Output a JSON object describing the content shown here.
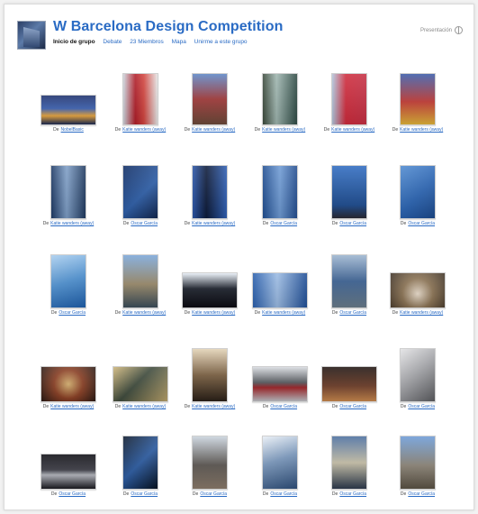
{
  "header": {
    "title": "W Barcelona Design Competition",
    "nav": [
      {
        "label": "Inicio de grupo",
        "current": true
      },
      {
        "label": "Debate",
        "current": false
      },
      {
        "label": "23 Miembros",
        "current": false
      },
      {
        "label": "Mapa",
        "current": false
      },
      {
        "label": "Unirme a este grupo",
        "current": false
      }
    ],
    "top_right": "Presentación"
  },
  "by_label": "De",
  "rows": [
    [
      {
        "author": "NobelBasic",
        "w": 62,
        "h": 34,
        "bg": "linear-gradient(180deg,#1c2f6b 0%,#3a5fb0 45%,#e6a33c 70%,#1a2a55 100%)"
      },
      {
        "author": "Katie wanders (away)",
        "w": 40,
        "h": 58,
        "bg": "linear-gradient(90deg,#cfd6de 0%,#b01f2a 35%,#d2453f 60%,#e6e6e6 100%)"
      },
      {
        "author": "Katie wanders (away)",
        "w": 40,
        "h": 58,
        "bg": "linear-gradient(180deg,#5d86c6 0%,#a23a3a 50%,#6b4a3a 100%)"
      },
      {
        "author": "Katie wanders (away)",
        "w": 40,
        "h": 58,
        "bg": "linear-gradient(90deg,#3b4a3c 0%,#9fb6b0 40%,#2e4a44 100%)"
      },
      {
        "author": "Katie wanders (away)",
        "w": 40,
        "h": 58,
        "bg": "linear-gradient(90deg,#b3c6dd 0%,#cf2b3c 40%,#c43044 100%)"
      },
      {
        "author": "Katie wanders (away)",
        "w": 40,
        "h": 58,
        "bg": "linear-gradient(180deg,#3a5ba8 0%,#c33b35 55%,#e0b43a 100%)"
      }
    ],
    [
      {
        "author": "Katie wanders (away)",
        "w": 40,
        "h": 60,
        "bg": "linear-gradient(90deg,#1f3b66 0%,#7f9fc7 45%,#203a60 100%)"
      },
      {
        "author": "Oscar García",
        "w": 40,
        "h": 60,
        "bg": "linear-gradient(135deg,#0f2c63 0%,#2d5ea8 55%,#13274f 100%)"
      },
      {
        "author": "Katie wanders (away)",
        "w": 40,
        "h": 60,
        "bg": "linear-gradient(90deg,#2a55a8 0%,#0d1b3a 40%,#2f5fb4 100%)"
      },
      {
        "author": "Oscar García",
        "w": 40,
        "h": 60,
        "bg": "linear-gradient(90deg,#214f92 0%,#6f9bd4 50%,#234d8f 100%)"
      },
      {
        "author": "Oscar García",
        "w": 40,
        "h": 60,
        "bg": "linear-gradient(180deg,#2f6bc0 0%,#1c4b8f 75%,#2a2a35 100%)"
      },
      {
        "author": "Oscar García",
        "w": 40,
        "h": 60,
        "bg": "linear-gradient(135deg,#4f8ad0 0%,#2a64b3 55%,#1d4a8c 100%)"
      }
    ],
    [
      {
        "author": "Oscar García",
        "w": 40,
        "h": 60,
        "bg": "linear-gradient(160deg,#a8cdee 0%,#4f92d2 50%,#1f5fab 100%)"
      },
      {
        "author": "Katie wanders (away)",
        "w": 40,
        "h": 60,
        "bg": "linear-gradient(180deg,#7aa6d8 0%,#9a8a6a 55%,#3b4d5a 100%)"
      },
      {
        "author": "Katie wanders (away)",
        "w": 62,
        "h": 40,
        "bg": "linear-gradient(180deg,#e6edf5 0%,#1a1f2a 45%,#0c0c12 100%)"
      },
      {
        "author": "Katie wanders (away)",
        "w": 62,
        "h": 40,
        "bg": "linear-gradient(90deg,#2a5fad 0%,#9bbbe3 45%,#1f4e96 100%)"
      },
      {
        "author": "Oscar García",
        "w": 40,
        "h": 60,
        "bg": "linear-gradient(180deg,#9cb4cf 0%,#3c6294 50%,#6a7c8a 100%)"
      },
      {
        "author": "Katie wanders (away)",
        "w": 62,
        "h": 40,
        "bg": "radial-gradient(circle at 50% 60%,#e9dccb 0%,#8b7354 45%,#3e3226 100%)"
      }
    ],
    [
      {
        "author": "Katie wanders (away)",
        "w": 62,
        "h": 40,
        "bg": "radial-gradient(circle at 50% 50%,#d6b170 0%,#8a3f24 45%,#2a1a14 100%)"
      },
      {
        "author": "Katie wanders (away)",
        "w": 62,
        "h": 40,
        "bg": "linear-gradient(135deg,#cdb57a 0%,#3e4a3c 45%,#b9a26a 100%)"
      },
      {
        "author": "Katie wanders (away)",
        "w": 40,
        "h": 60,
        "bg": "linear-gradient(180deg,#e2d2b5 0%,#7b6042 50%,#2a2018 100%)"
      },
      {
        "author": "Oscar García",
        "w": 62,
        "h": 40,
        "bg": "linear-gradient(180deg,#d7dadf 0%,#55595e 45%,#9a1e22 60%,#bfc3c8 100%)"
      },
      {
        "author": "Oscar García",
        "w": 62,
        "h": 40,
        "bg": "linear-gradient(180deg,#1f1410 0%,#6a3a26 55%,#c9884e 100%)"
      },
      {
        "author": "Oscar García",
        "w": 40,
        "h": 60,
        "bg": "linear-gradient(135deg,#e2e2e4 0%,#a8a9ad 45%,#5b5c60 100%)"
      }
    ],
    [
      {
        "author": "Oscar García",
        "w": 62,
        "h": 40,
        "bg": "linear-gradient(180deg,#0d0d12 0%,#3a3a44 45%,#b0b2ba 60%,#1a1a20 100%)"
      },
      {
        "author": "Oscar García",
        "w": 40,
        "h": 60,
        "bg": "linear-gradient(135deg,#0c1a2e 0%,#2a5aa0 50%,#071222 100%)"
      },
      {
        "author": "Oscar García",
        "w": 40,
        "h": 60,
        "bg": "linear-gradient(180deg,#c9d2dc 0%,#5a5550 55%,#8a7a6a 100%)"
      },
      {
        "author": "Oscar García",
        "w": 40,
        "h": 60,
        "bg": "linear-gradient(160deg,#e8eef5 0%,#7a98bd 45%,#2f4f7a 100%)"
      },
      {
        "author": "Oscar García",
        "w": 40,
        "h": 60,
        "bg": "linear-gradient(180deg,#4a6d9e 0%,#c7c0a8 50%,#2d3a4d 100%)"
      },
      {
        "author": "Oscar García",
        "w": 40,
        "h": 60,
        "bg": "linear-gradient(180deg,#6c9bd6 0%,#8d8578 55%,#5a5244 100%)"
      }
    ]
  ]
}
